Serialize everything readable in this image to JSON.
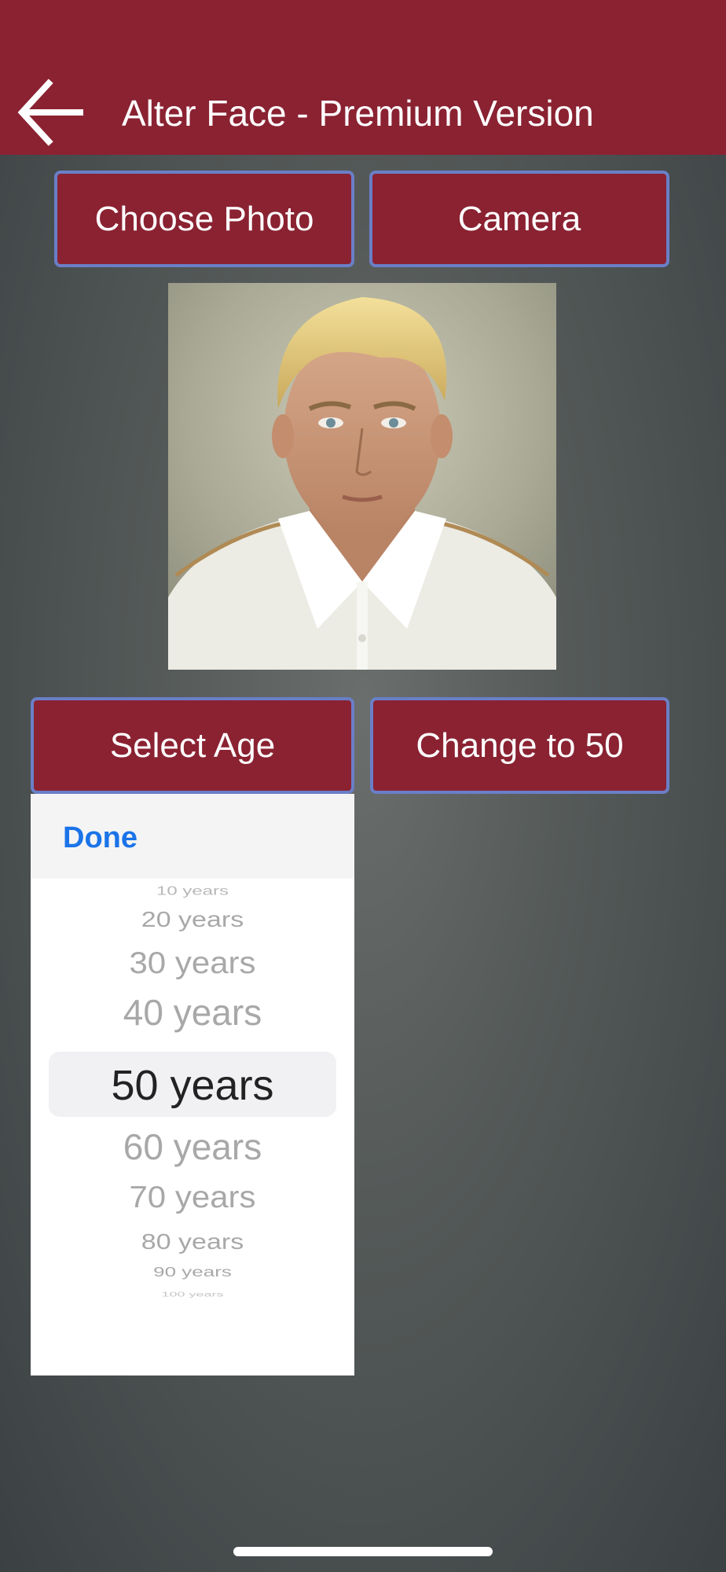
{
  "header": {
    "title": "Alter Face - Premium Version",
    "back_icon": "arrow-left-icon",
    "background_color": "#8a2232"
  },
  "buttons": {
    "choose_photo": "Choose Photo",
    "camera": "Camera",
    "select_age": "Select Age",
    "change_to": "Change to 50"
  },
  "picker": {
    "done_label": "Done",
    "selected": "50 years",
    "options": [
      "10 years",
      "20 years",
      "30 years",
      "40 years",
      "50 years",
      "60 years",
      "70 years",
      "80 years",
      "90 years",
      "100 years"
    ]
  },
  "colors": {
    "accent": "#8a2232",
    "button_border": "#6a7fc7",
    "done_blue": "#1a73e8"
  }
}
